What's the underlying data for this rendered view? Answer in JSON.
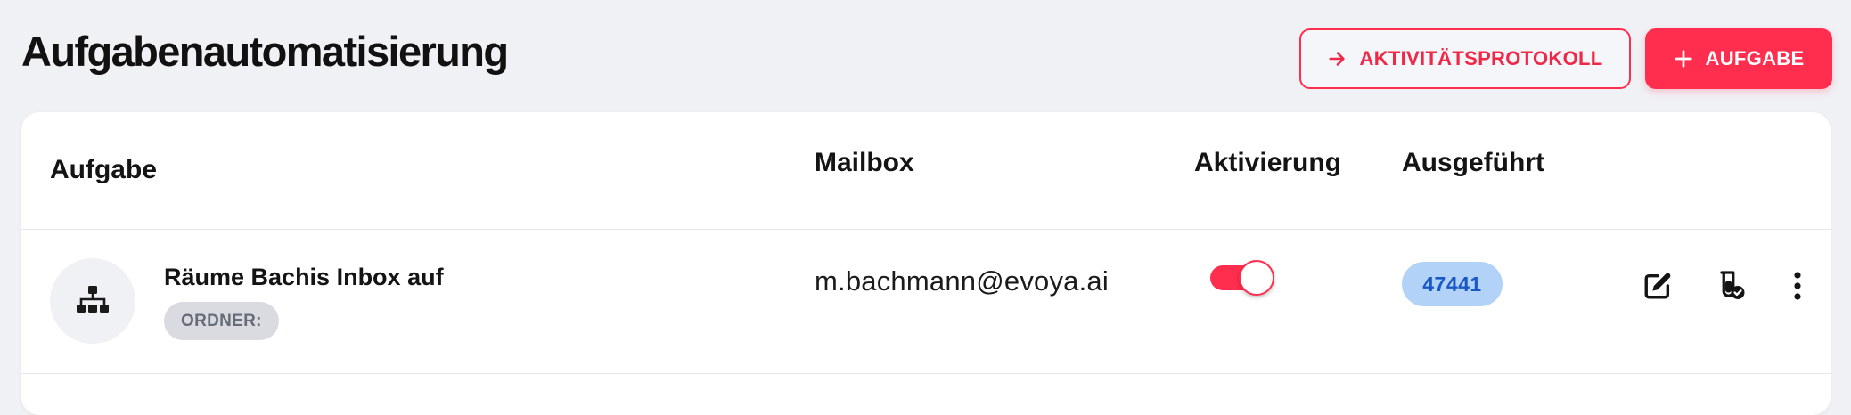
{
  "header": {
    "title": "Aufgabenautomatisierung",
    "activity_log_label": "AKTIVITÄTSPROTOKOLL",
    "add_task_label": "AUFGABE"
  },
  "table": {
    "columns": {
      "task": "Aufgabe",
      "mailbox": "Mailbox",
      "activation": "Aktivierung",
      "executed": "Ausgeführt"
    },
    "rows": [
      {
        "name": "Räume Bachis Inbox auf",
        "folder_chip": "ORDNER:",
        "mailbox": "m.bachmann@evoya.ai",
        "active": true,
        "executed_count": "47441",
        "icons": [
          "sitemap-icon",
          "edit-icon",
          "test-tube-check-icon",
          "more-vertical-icon"
        ]
      }
    ]
  },
  "colors": {
    "accent": "#ff2e4f",
    "badge_bg": "#b3d2f8",
    "badge_text": "#1a58c4",
    "background": "#f0f1f5"
  }
}
